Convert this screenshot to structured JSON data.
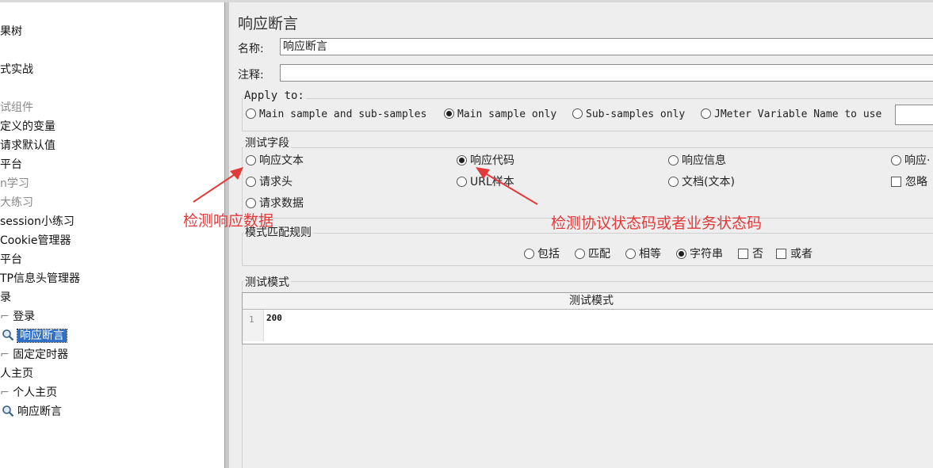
{
  "tree": {
    "items": [
      {
        "label": "果树",
        "dim": false
      },
      {
        "label": "式实战",
        "dim": false
      },
      {
        "label": "试组件",
        "dim": true
      },
      {
        "label": "定义的变量",
        "dim": false
      },
      {
        "label": "请求默认值",
        "dim": false
      },
      {
        "label": "平台",
        "dim": false
      },
      {
        "label": "n学习",
        "dim": true
      },
      {
        "label": "大练习",
        "dim": true
      },
      {
        "label": "session小练习",
        "dim": false
      },
      {
        "label": " Cookie管理器",
        "dim": false
      },
      {
        "label": "平台",
        "dim": false
      },
      {
        "label": "TP信息头管理器",
        "dim": false
      },
      {
        "label": "录",
        "dim": false
      },
      {
        "label": "登录",
        "dim": false
      },
      {
        "label": "响应断言",
        "dim": false,
        "selected": true,
        "icon": "magnifier-icon"
      },
      {
        "label": "固定定时器",
        "dim": false
      },
      {
        "label": "人主页",
        "dim": false
      },
      {
        "label": "个人主页",
        "dim": false
      },
      {
        "label": "响应断言",
        "dim": false,
        "icon": "magnifier-icon"
      }
    ]
  },
  "panel": {
    "title": "响应断言",
    "name_label": "名称:",
    "name_value": "响应断言",
    "comment_label": "注释:",
    "comment_value": "",
    "apply_to": {
      "legend": "Apply to:",
      "options": [
        "Main sample and sub-samples",
        "Main sample only",
        "Sub-samples only",
        "JMeter Variable Name to use"
      ],
      "selected": "Main sample only"
    },
    "field": {
      "legend": "测试字段",
      "options": [
        "响应文本",
        "响应代码",
        "响应信息",
        "响应头",
        "请求头",
        "URL样本",
        "文档(文本)",
        "忽略状态",
        "请求数据"
      ],
      "selected": "响应代码",
      "visible_partial": {
        "响应头": "响应·",
        "忽略状态": "忽略"
      }
    },
    "pattern_rules": {
      "legend": "模式匹配规则",
      "options": [
        "包括",
        "匹配",
        "相等",
        "字符串",
        "否",
        "或者"
      ],
      "selected": "字符串"
    },
    "test_patterns": {
      "legend": "测试模式",
      "column_header": "测试模式",
      "rows": [
        {
          "line": "1",
          "value": "200"
        }
      ]
    }
  },
  "annotations": {
    "left_note": "检测响应数据",
    "right_note": "检测协议状态码或者业务状态码",
    "color": "#e23a3a"
  }
}
